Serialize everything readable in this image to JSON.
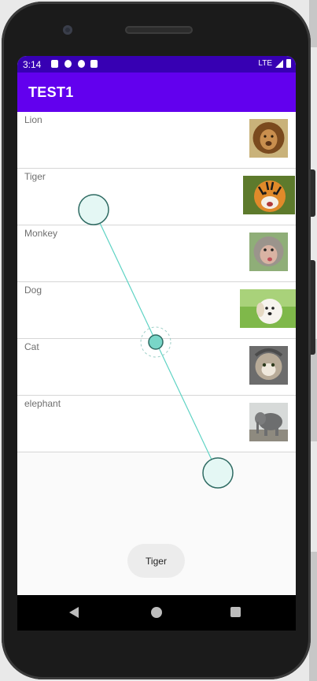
{
  "status_bar": {
    "time": "3:14",
    "network": "LTE"
  },
  "app_bar": {
    "title": "TEST1"
  },
  "animals": [
    {
      "label": "Lion"
    },
    {
      "label": "Tiger"
    },
    {
      "label": "Monkey"
    },
    {
      "label": "Dog"
    },
    {
      "label": "Cat"
    },
    {
      "label": "elephant"
    }
  ],
  "toast": {
    "text": "Tiger"
  },
  "nav_bar": {
    "back_icon": "triangle-back-icon",
    "home_icon": "circle-home-icon",
    "recent_icon": "square-recents-icon"
  },
  "colors": {
    "status_bar": "#3700b3",
    "app_bar": "#6200ee",
    "gesture_line": "#5fd3c4"
  }
}
